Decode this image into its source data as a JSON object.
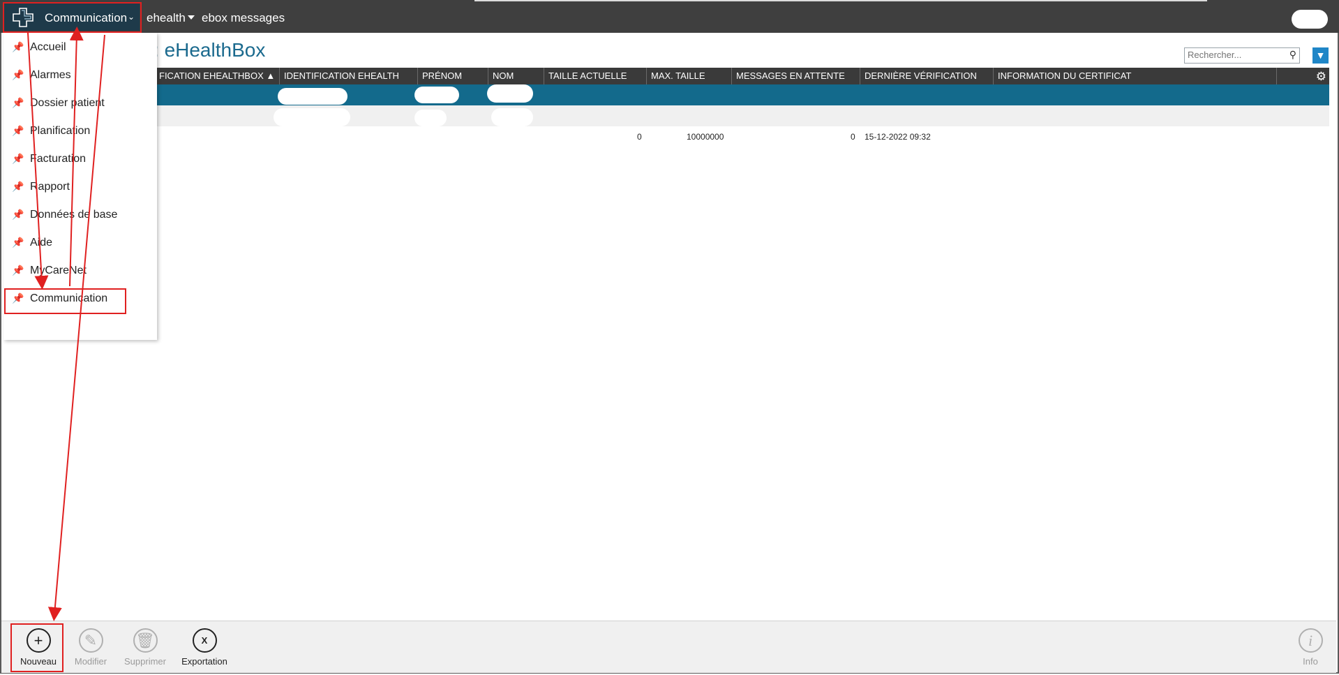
{
  "topbar": {
    "brand_label": "Communication",
    "nav": [
      {
        "label": "ehealth",
        "has_caret": true
      },
      {
        "label": "ebox messages",
        "has_caret": false
      }
    ]
  },
  "page": {
    "title": "eHealthBox",
    "title_prefix_fragment": ":"
  },
  "search": {
    "placeholder": "Rechercher..."
  },
  "table": {
    "columns": [
      "FICATION EHEALTHBOX ▲",
      "IDENTIFICATION EHEALTH",
      "PRÉNOM",
      "NOM",
      "TAILLE ACTUELLE",
      "MAX. TAILLE",
      "MESSAGES EN ATTENTE",
      "DERNIÈRE VÉRIFICATION",
      "INFORMATION DU CERTIFICAT"
    ],
    "row_values": {
      "taille_actuelle": "0",
      "max_taille": "10000000",
      "messages_en_attente": "0",
      "derniere_verification": "15-12-2022 09:32"
    }
  },
  "menu": {
    "items": [
      {
        "label": "Accueil",
        "pinned": true
      },
      {
        "label": "Alarmes",
        "pinned": false
      },
      {
        "label": "Dossier patient",
        "pinned": false
      },
      {
        "label": "Planification",
        "pinned": false
      },
      {
        "label": "Facturation",
        "pinned": false
      },
      {
        "label": "Rapport",
        "pinned": false
      },
      {
        "label": "Données de base",
        "pinned": false
      },
      {
        "label": "Aide",
        "pinned": false
      },
      {
        "label": "MyCareNet",
        "pinned": false
      },
      {
        "label": "Communication",
        "pinned": false
      }
    ]
  },
  "toolbar": {
    "nouveau": "Nouveau",
    "modifier": "Modifier",
    "supprimer": "Supprimer",
    "exportation": "Exportation",
    "info": "Info"
  },
  "colors": {
    "topbar": "#3f3f3f",
    "brand": "#1e3a4a",
    "accent": "#1b6a8e",
    "selected_row": "#136a8c",
    "annotation": "#e02020"
  }
}
